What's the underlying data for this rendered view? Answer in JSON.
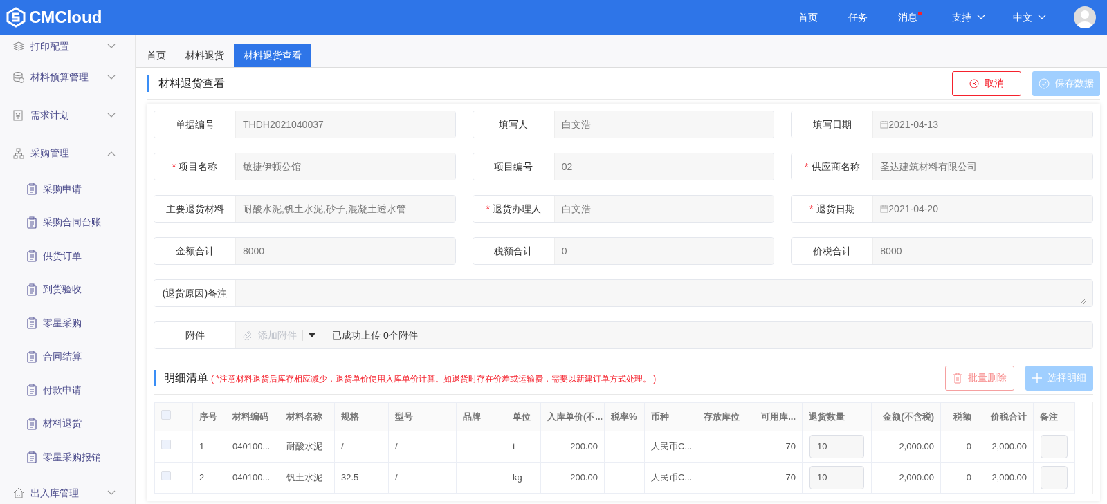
{
  "header": {
    "logo": "CMCloud",
    "nav": [
      {
        "label": "首页",
        "kind": "link",
        "badge": false
      },
      {
        "label": "任务",
        "kind": "link",
        "badge": false
      },
      {
        "label": "消息",
        "kind": "link",
        "badge": true
      },
      {
        "label": "支持",
        "kind": "dropdown",
        "badge": false
      },
      {
        "label": "中文",
        "kind": "dropdown",
        "badge": false
      }
    ]
  },
  "sidebar": {
    "items": [
      {
        "label": "打印配置",
        "expanded": false
      },
      {
        "label": "材料预算管理",
        "expanded": false
      },
      {
        "label": "需求计划",
        "expanded": false
      },
      {
        "label": "采购管理",
        "expanded": true,
        "children": [
          {
            "label": "采购申请"
          },
          {
            "label": "采购合同台账"
          },
          {
            "label": "供货订单"
          },
          {
            "label": "到货验收"
          },
          {
            "label": "零星采购"
          },
          {
            "label": "合同结算"
          },
          {
            "label": "付款申请"
          },
          {
            "label": "材料退货"
          },
          {
            "label": "零星采购报销"
          }
        ]
      },
      {
        "label": "出入库管理",
        "expanded": false
      }
    ]
  },
  "tabs": [
    {
      "label": "首页",
      "selected": false
    },
    {
      "label": "材料退货",
      "selected": false
    },
    {
      "label": "材料退货查看",
      "selected": true
    }
  ],
  "page": {
    "title": "材料退货查看",
    "buttons": [
      {
        "label": "取消",
        "kind": "cancel",
        "disabled": false
      },
      {
        "label": "保存数据",
        "kind": "save",
        "disabled": true
      }
    ]
  },
  "form": {
    "fields": [
      {
        "label": "单据编号",
        "value": "THDH2021040037",
        "required": false,
        "kind": "text"
      },
      {
        "label": "填写人",
        "value": "白文浩",
        "required": false,
        "kind": "text"
      },
      {
        "label": "填写日期",
        "value": "2021-04-13",
        "required": false,
        "kind": "date"
      },
      {
        "label": "项目名称",
        "value": "敏捷伊顿公馆",
        "required": true,
        "required_mark": "*",
        "kind": "text"
      },
      {
        "label": "项目编号",
        "value": "02",
        "required": false,
        "kind": "text"
      },
      {
        "label": "供应商名称",
        "value": "圣达建筑材料有限公司",
        "required": true,
        "required_mark": "*",
        "kind": "text"
      },
      {
        "label": "主要退货材料",
        "value": "耐酸水泥,钒土水泥,砂子,混凝土透水管",
        "required": false,
        "kind": "text"
      },
      {
        "label": "退货办理人",
        "value": "白文浩",
        "required": true,
        "required_mark": "*",
        "kind": "text"
      },
      {
        "label": "退货日期",
        "value": "2021-04-20",
        "required": true,
        "required_mark": "*",
        "kind": "date"
      },
      {
        "label": "金额合计",
        "value": "8000",
        "required": false,
        "kind": "text"
      },
      {
        "label": "税额合计",
        "value": "0",
        "required": false,
        "kind": "text"
      },
      {
        "label": "价税合计",
        "value": "8000",
        "required": false,
        "kind": "text"
      },
      {
        "label": "(退货原因)备注",
        "required": false,
        "kind": "textarea"
      },
      {
        "label": "附件",
        "placeholder": "添加附件",
        "status": "已成功上传 0个附件",
        "required": false,
        "kind": "attachment"
      }
    ]
  },
  "detail": {
    "title": "明细清单",
    "note": "( *注意材料退货后库存相应减少，退货单价使用入库单价计算。如退货时存在价差或运输费，需要以新建订单方式处理。 )",
    "buttons": [
      {
        "label": "批量删除",
        "kind": "delete",
        "disabled": true
      },
      {
        "label": "选择明细",
        "kind": "add",
        "disabled": true
      }
    ],
    "select_all": {
      "checked": false
    },
    "columns": [
      {
        "label": "序号",
        "kind": "text"
      },
      {
        "label": "材料编码",
        "kind": "text"
      },
      {
        "label": "材料名称",
        "kind": "text"
      },
      {
        "label": "规格",
        "kind": "text"
      },
      {
        "label": "型号",
        "kind": "text"
      },
      {
        "label": "品牌",
        "kind": "text"
      },
      {
        "label": "单位",
        "kind": "text"
      },
      {
        "label": "入库单价(不...",
        "kind": "number"
      },
      {
        "label": "税率%",
        "kind": "text"
      },
      {
        "label": "币种",
        "kind": "text"
      },
      {
        "label": "存放库位",
        "kind": "text"
      },
      {
        "label": "可用库...",
        "kind": "number"
      },
      {
        "label": "退货数量",
        "kind": "input"
      },
      {
        "label": "金额(不含税)",
        "kind": "number"
      },
      {
        "label": "税额",
        "kind": "number"
      },
      {
        "label": "价税合计",
        "kind": "number"
      },
      {
        "label": "备注",
        "kind": "input"
      }
    ],
    "rows": [
      {
        "checked": false,
        "cells": [
          "1",
          "040100...",
          "耐酸水泥",
          "/",
          "/",
          null,
          "t",
          "200.00",
          null,
          "人民币C...",
          null,
          "70",
          "10",
          "2,000.00",
          "0",
          "2,000.00",
          null
        ]
      },
      {
        "checked": false,
        "cells": [
          "2",
          "040100...",
          "钒土水泥",
          "32.5",
          "/",
          null,
          "kg",
          "200.00",
          null,
          "人民币C...",
          null,
          "70",
          "10",
          "2,000.00",
          "0",
          "2,000.00",
          null
        ]
      }
    ]
  }
}
